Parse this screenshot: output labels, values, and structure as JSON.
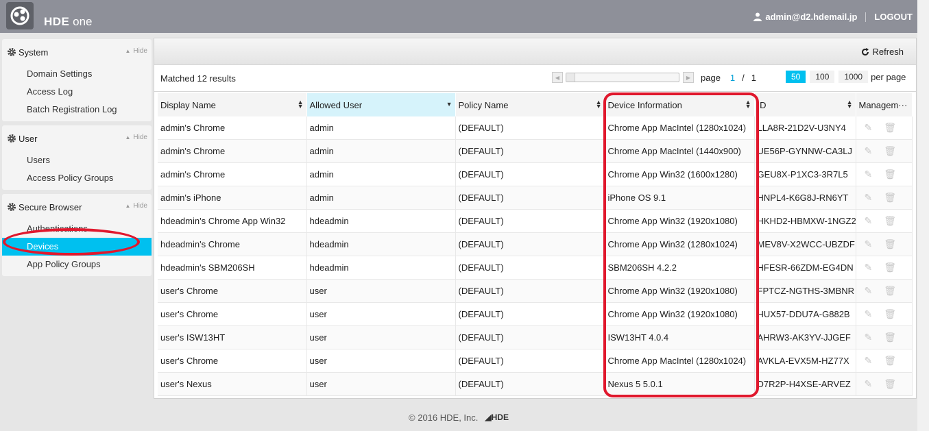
{
  "header": {
    "brand_main": "HDE",
    "brand_sub": "one",
    "user_email": "admin@d2.hdemail.jp",
    "logout_label": "LOGOUT"
  },
  "sidebar": {
    "hide_label": "Hide",
    "groups": [
      {
        "title": "System",
        "items": [
          "Domain Settings",
          "Access Log",
          "Batch Registration Log"
        ]
      },
      {
        "title": "User",
        "items": [
          "Users",
          "Access Policy Groups"
        ]
      },
      {
        "title": "Secure Browser",
        "items": [
          "Authentications",
          "Devices",
          "App Policy Groups"
        ]
      }
    ],
    "active_item": "Devices"
  },
  "toolbar": {
    "refresh_label": "Refresh"
  },
  "pager": {
    "matched_text": "Matched 12 results",
    "page_label": "page",
    "current_page": "1",
    "separator": "/",
    "total_pages": "1",
    "per_page_options": [
      "50",
      "100",
      "1000"
    ],
    "per_page_selected": "50",
    "per_page_label": "per page"
  },
  "table": {
    "columns": [
      "Display Name",
      "Allowed User",
      "Policy Name",
      "Device Information",
      "ID",
      "Managem···"
    ],
    "sorted_column": "Allowed User",
    "rows": [
      [
        "admin's Chrome",
        "admin",
        "(DEFAULT)",
        "Chrome App MacIntel (1280x1024)",
        "LLA8R-21D2V-U3NY4"
      ],
      [
        "admin's Chrome",
        "admin",
        "(DEFAULT)",
        "Chrome App MacIntel (1440x900)",
        "UE56P-GYNNW-CA3LJ"
      ],
      [
        "admin's Chrome",
        "admin",
        "(DEFAULT)",
        "Chrome App Win32 (1600x1280)",
        "GEU8X-P1XC3-3R7L5"
      ],
      [
        "admin's iPhone",
        "admin",
        "(DEFAULT)",
        "iPhone OS 9.1",
        "HNPL4-K6G8J-RN6YT"
      ],
      [
        "hdeadmin's Chrome App Win32",
        "hdeadmin",
        "(DEFAULT)",
        "Chrome App Win32 (1920x1080)",
        "HKHD2-HBMXW-1NGZ2"
      ],
      [
        "hdeadmin's Chrome",
        "hdeadmin",
        "(DEFAULT)",
        "Chrome App Win32 (1280x1024)",
        "MEV8V-X2WCC-UBZDF"
      ],
      [
        "hdeadmin's SBM206SH",
        "hdeadmin",
        "(DEFAULT)",
        "SBM206SH 4.2.2",
        "HFESR-66ZDM-EG4DN"
      ],
      [
        "user's Chrome",
        "user",
        "(DEFAULT)",
        "Chrome App Win32 (1920x1080)",
        "FPTCZ-NGTHS-3MBNR"
      ],
      [
        "user's Chrome",
        "user",
        "(DEFAULT)",
        "Chrome App Win32 (1920x1080)",
        "HUX57-DDU7A-G882B"
      ],
      [
        "user's ISW13HT",
        "user",
        "(DEFAULT)",
        "ISW13HT 4.0.4",
        "AHRW3-AK3YV-JJGEF"
      ],
      [
        "user's Chrome",
        "user",
        "(DEFAULT)",
        "Chrome App MacIntel (1280x1024)",
        "AVKLA-EVX5M-HZ77X"
      ],
      [
        "user's Nexus",
        "user",
        "(DEFAULT)",
        "Nexus 5 5.0.1",
        "D7R2P-H4XSE-ARVEZ"
      ]
    ]
  },
  "footer": {
    "copyright": "© 2016 HDE, Inc.",
    "logo_text": "HDE"
  },
  "colors": {
    "accent": "#00c0ef",
    "header_bg": "#8e9099",
    "highlight": "#e0182d"
  }
}
